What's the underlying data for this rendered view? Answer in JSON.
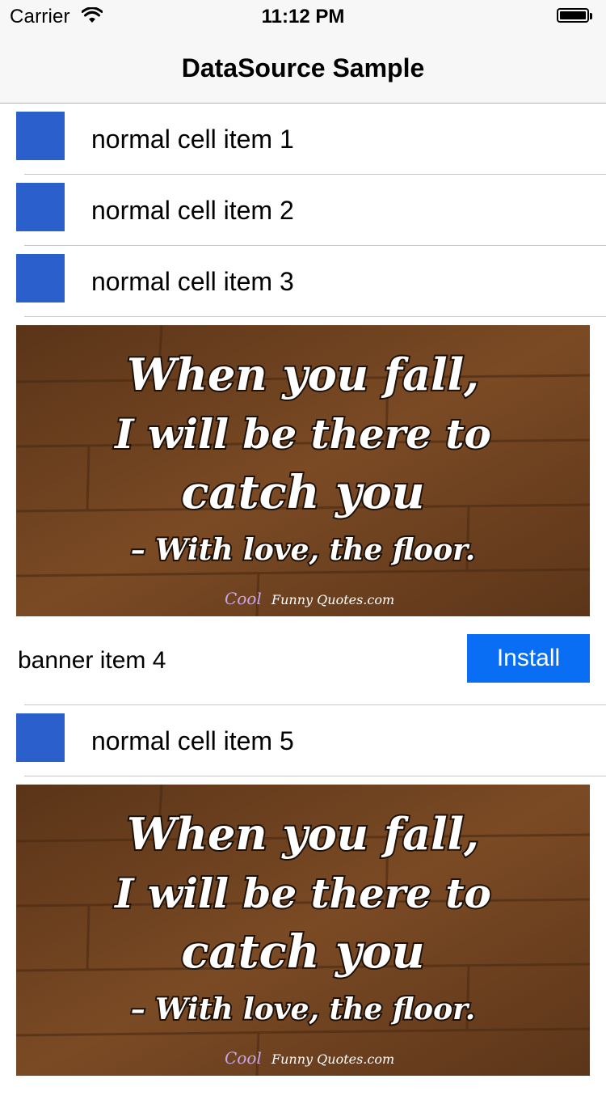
{
  "status_bar": {
    "carrier": "Carrier",
    "time": "11:12 PM",
    "wifi_icon": "wifi-icon",
    "battery_icon": "battery-full-icon"
  },
  "nav": {
    "title": "DataSource Sample"
  },
  "colors": {
    "thumb": "#2b60cc",
    "install_button": "#0a6ef5",
    "separator": "#c8c7cc",
    "wood": "#6b3e1c"
  },
  "list": {
    "cell_1": {
      "label": "normal cell item 1"
    },
    "cell_2": {
      "label": "normal cell item 2"
    },
    "cell_3": {
      "label": "normal cell item 3"
    },
    "banner_4": {
      "label": "banner item 4",
      "button_label": "Install",
      "image": {
        "line1": "When you fall,",
        "line2": "I will be there to",
        "line3": "catch you",
        "line4": "– With love, the floor.",
        "watermark_a": "Cool",
        "watermark_b": "Funny Quotes.com"
      }
    },
    "cell_5": {
      "label": "normal cell item 5"
    },
    "banner_6": {
      "image": {
        "line1": "When you fall,",
        "line2": "I will be there to",
        "line3": "catch you",
        "line4": "– With love, the floor.",
        "watermark_a": "Cool",
        "watermark_b": "Funny Quotes.com"
      }
    }
  }
}
